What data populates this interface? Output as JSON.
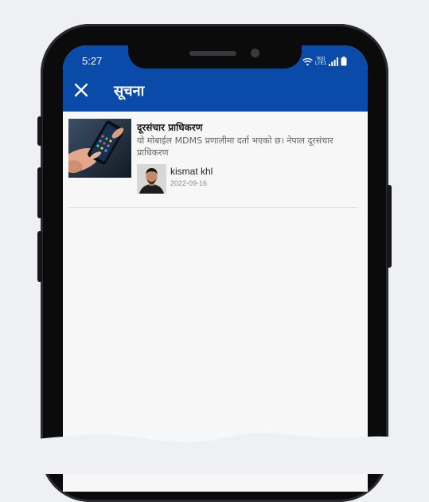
{
  "status_bar": {
    "time": "5:27",
    "network_label": "Vo)) LTE1"
  },
  "app_bar": {
    "title": "सूचना",
    "close_icon": "close-icon"
  },
  "notifications": [
    {
      "title": "दूरसंचार प्राधिकरण",
      "description": "यो मोबाईल MDMS प्रणालीमा दर्ता भएको छ। नेपाल दूरसंचार प्राधिकरण",
      "author": "kismat khl",
      "date": "2022-09-16"
    }
  ],
  "colors": {
    "app_bar": "#0a4aa8",
    "background": "#f7f7f8",
    "frame": "#0b0b0c"
  }
}
